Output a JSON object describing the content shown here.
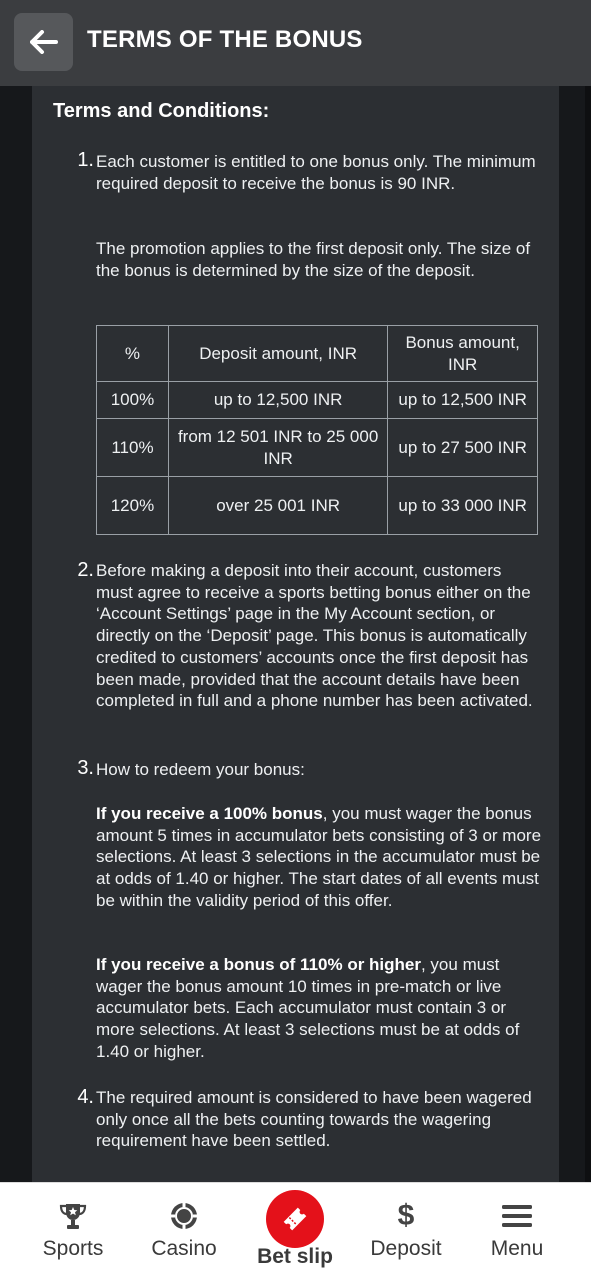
{
  "header": {
    "title": "TERMS OF THE BONUS"
  },
  "section_title": "Terms and Conditions:",
  "items": [
    {
      "number": "1.",
      "p1": "Each customer is entitled to one bonus only. The minimum required deposit to receive the bonus is 90 INR.",
      "p2": "The promotion applies to the first deposit only. The size of the bonus is determined by the size of the deposit."
    },
    {
      "number": "2.",
      "p1": "Before making a deposit into their account, customers must agree to receive a sports betting bonus either on the ‘Account Settings’ page in the My Account section, or directly on the ‘Deposit’ page. This bonus is automatically credited to customers’ accounts once the first deposit has been made, provided that the account details have been completed in full and a phone number has been activated."
    },
    {
      "number": "3.",
      "p1": "How to redeem your bonus:",
      "p2_bold": "If you receive a 100% bonus",
      "p2_rest": ", you must wager the bonus amount 5 times in accumulator bets consisting of 3 or more selections. At least 3 selections in the accumulator must be at odds of 1.40 or higher. The start dates of all events must be within the validity period of this offer.",
      "p3_bold": "If you receive a bonus of 110% or higher",
      "p3_rest": ", you must wager the bonus amount 10 times in pre-match or live accumulator bets. Each accumulator must contain 3 or more selections. At least 3 selections must be at odds of 1.40 or higher."
    },
    {
      "number": "4.",
      "p1": "The required amount is considered to have been wagered only once all the bets counting towards the wagering requirement have been settled."
    }
  ],
  "table": {
    "headers": [
      "%",
      "Deposit amount, INR",
      "Bonus amount, INR"
    ],
    "rows": [
      [
        "100%",
        "up to 12,500 INR",
        "up to 12,500 INR"
      ],
      [
        "110%",
        "from 12 501 INR to 25 000 INR",
        "up to 27 500 INR"
      ],
      [
        "120%",
        "over 25 001 INR",
        "up to 33 000 INR"
      ]
    ]
  },
  "nav": {
    "sports": "Sports",
    "casino": "Casino",
    "betslip": "Bet slip",
    "deposit": "Deposit",
    "menu": "Menu"
  },
  "colors": {
    "accent_red": "#e4111a",
    "header_bg": "#3b3d40",
    "content_bg": "#2c2f33"
  },
  "icons": {
    "back": "arrow-left-icon",
    "sports": "trophy-icon",
    "casino": "poker-chip-icon",
    "betslip": "ticket-icon",
    "deposit": "dollar-icon",
    "menu": "hamburger-icon"
  }
}
